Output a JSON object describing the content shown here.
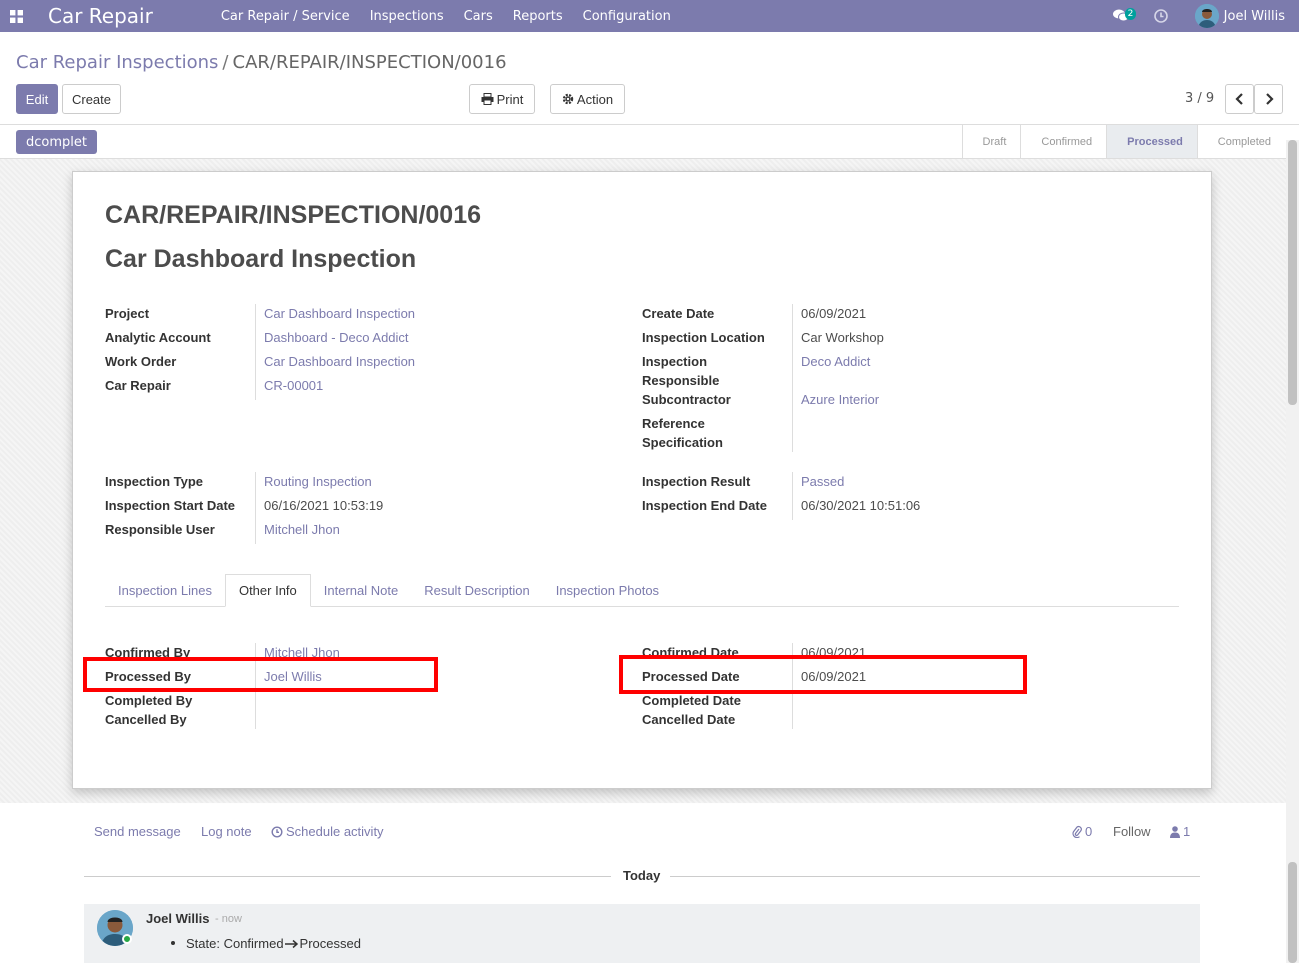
{
  "navbar": {
    "app_title": "Car Repair",
    "menu": [
      "Car Repair / Service",
      "Inspections",
      "Cars",
      "Reports",
      "Configuration"
    ],
    "chat_count": "2",
    "user_name": "Joel Willis"
  },
  "breadcrumb": {
    "parent": "Car Repair Inspections",
    "separator": "/",
    "current": "CAR/REPAIR/INSPECTION/0016"
  },
  "toolbar": {
    "edit": "Edit",
    "create": "Create",
    "print": "Print",
    "action": "Action",
    "pager": "3 / 9"
  },
  "statusbar": {
    "tag": "dcomplet",
    "stages": [
      "Draft",
      "Confirmed",
      "Processed",
      "Completed"
    ],
    "active_stage": "Processed"
  },
  "form": {
    "name": "CAR/REPAIR/INSPECTION/0016",
    "subtitle": "Car Dashboard Inspection",
    "left_group": [
      {
        "label": "Project",
        "value": "Car Dashboard Inspection"
      },
      {
        "label": "Analytic Account",
        "value": "Dashboard - Deco Addict"
      },
      {
        "label": "Work Order",
        "value": "Car Dashboard Inspection"
      },
      {
        "label": "Car Repair",
        "value": "CR-00001"
      }
    ],
    "right_group": {
      "create_date_label": "Create Date",
      "create_date": "06/09/2021",
      "location_label": "Inspection Location",
      "location": "Car Workshop",
      "responsible_label_1": "Inspection",
      "responsible_label_2": "Responsible",
      "responsible": "Deco Addict",
      "subcontractor_label": "Subcontractor",
      "subcontractor": "Azure Interior",
      "reference_label_1": "Reference",
      "reference_label_2": "Specification"
    },
    "left_group2": [
      {
        "label": "Inspection Type",
        "value": "Routing Inspection"
      },
      {
        "label": "Inspection Start Date",
        "value": "06/16/2021 10:53:19"
      },
      {
        "label": "Responsible User",
        "value": "Mitchell Jhon"
      }
    ],
    "right_group2": [
      {
        "label": "Inspection Result",
        "value": "Passed"
      },
      {
        "label": "Inspection End Date",
        "value": "06/30/2021 10:51:06"
      }
    ],
    "tabs": [
      "Inspection Lines",
      "Other Info",
      "Internal Note",
      "Result Description",
      "Inspection Photos"
    ],
    "active_tab": "Other Info",
    "other_info_left": [
      {
        "label": "Confirmed By",
        "value": "Mitchell Jhon"
      },
      {
        "label": "Processed By",
        "value": "Joel Willis"
      },
      {
        "label": "Completed By",
        "value": ""
      },
      {
        "label": "Cancelled By",
        "value": ""
      }
    ],
    "other_info_right": [
      {
        "label": "Confirmed Date",
        "value": "06/09/2021"
      },
      {
        "label": "Processed Date",
        "value": "06/09/2021"
      },
      {
        "label": "Completed Date",
        "value": ""
      },
      {
        "label": "Cancelled Date",
        "value": ""
      }
    ]
  },
  "chatter": {
    "send_message": "Send message",
    "log_note": "Log note",
    "schedule_activity": "Schedule activity",
    "attachments": "0",
    "follow": "Follow",
    "followers": "1",
    "date_separator": "Today",
    "messages": [
      {
        "author": "Joel Willis",
        "time": "- now",
        "change": "State: Confirmed",
        "new_value": "Processed"
      }
    ]
  },
  "colors": {
    "brand": "#7c7bad",
    "highlight": "#ff0000"
  }
}
